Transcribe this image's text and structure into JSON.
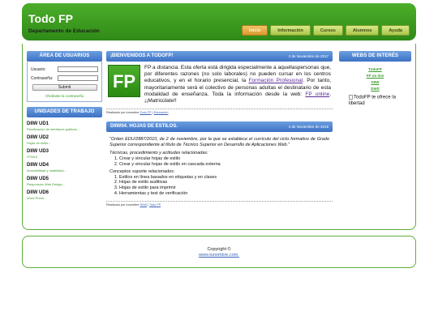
{
  "header": {
    "title": "Todo FP",
    "subtitle": "Departamento de Educación",
    "nav": [
      {
        "label": "Inicio",
        "active": true
      },
      {
        "label": "Información",
        "active": false
      },
      {
        "label": "Cursos",
        "active": false
      },
      {
        "label": "Alumnos",
        "active": false
      },
      {
        "label": "Ayuda",
        "active": false
      }
    ]
  },
  "sidebar": {
    "users_title": "ÁREA DE USUARIOS",
    "user_label": "Usuario:",
    "password_label": "Contraseña:",
    "submit_label": "Submit",
    "forgot_label": "Olvidaste la contraseña",
    "units_title": "UNIDADES DE TRABAJO",
    "units": [
      {
        "code": "DIIW UD1",
        "desc": "Planificación de interfaces gráficas..."
      },
      {
        "code": "DIIW UD2",
        "desc": "Hojas de estilo..."
      },
      {
        "code": "DIIW UD3",
        "desc": "HTML5"
      },
      {
        "code": "DIIW UD4",
        "desc": "Accesibilidad y usabilidad..."
      },
      {
        "code": "DIIW UD5",
        "desc": "Responsive Web Design..."
      },
      {
        "code": "DIIW UD6",
        "desc": "Word Press..."
      }
    ]
  },
  "posts": {
    "welcome": {
      "title": "¡BIENVENIDOS A TODOFP!",
      "date": "2 de Noviembre de 2017",
      "logo_text": "FP",
      "text_before": "FP a distancia. Esta oferta está dirigida especialmente a aquellaspersonas que, por diferentes razones (no solo laborales) no pueden cursar en los centros educativos, y en el horario presencial, la ",
      "link1": "Formación Profesional",
      "text_middle": ". Por tanto, mayoritariamente será el colectivo de personas adultas el destinatario de esta modalidad de enseñanza. Toda la información desde la web: ",
      "link2": "FP online",
      "text_after": ". ¡¡Matricúlate!!",
      "meta_prefix": "Realizado por tunombre ",
      "meta_link1": "Todo FP",
      "meta_sep": " | ",
      "meta_link2": "Educación"
    },
    "styles": {
      "title": "DIIW04. HOJAS DE ESTILOS.",
      "date": "2 de Noviembre de 2015",
      "quote": "\"Orden EDU/2887/2010, de 2 de noviembre, por la que se establece el currículo del ciclo formativo de Grado Superior correspondiente al título de Técnico Superior en Desarrollo de Aplicaciones Web.\"",
      "section1": "Técnicas, procedimiento y actitudes relacionadas:",
      "list1": [
        "Crear y vincular hojas de estilo",
        "Crear y vincular hojas de estilo en cascada externa"
      ],
      "section2": "Conceptos soporte relacionados:",
      "list2": [
        "Estilos en línea basados en etiquetas y en clases",
        "Hojas de estilo auditivas",
        "Hojas de estilo para imprimir",
        "Herramientas y test de verificación"
      ],
      "meta_prefix": "Realizado por tunombre ",
      "meta_link1": "DIIW",
      "meta_sep": " | ",
      "meta_link2": "Todo FP"
    }
  },
  "right": {
    "title": "WEBS DE INTERÉS",
    "links": [
      "TodoFP",
      "FP on line",
      "DIIW",
      "DWS"
    ],
    "img_alt": "TodoFP te ofrece la libertad"
  },
  "footer": {
    "copyright": "Copyright ©",
    "link": "www.tunombre.com."
  }
}
